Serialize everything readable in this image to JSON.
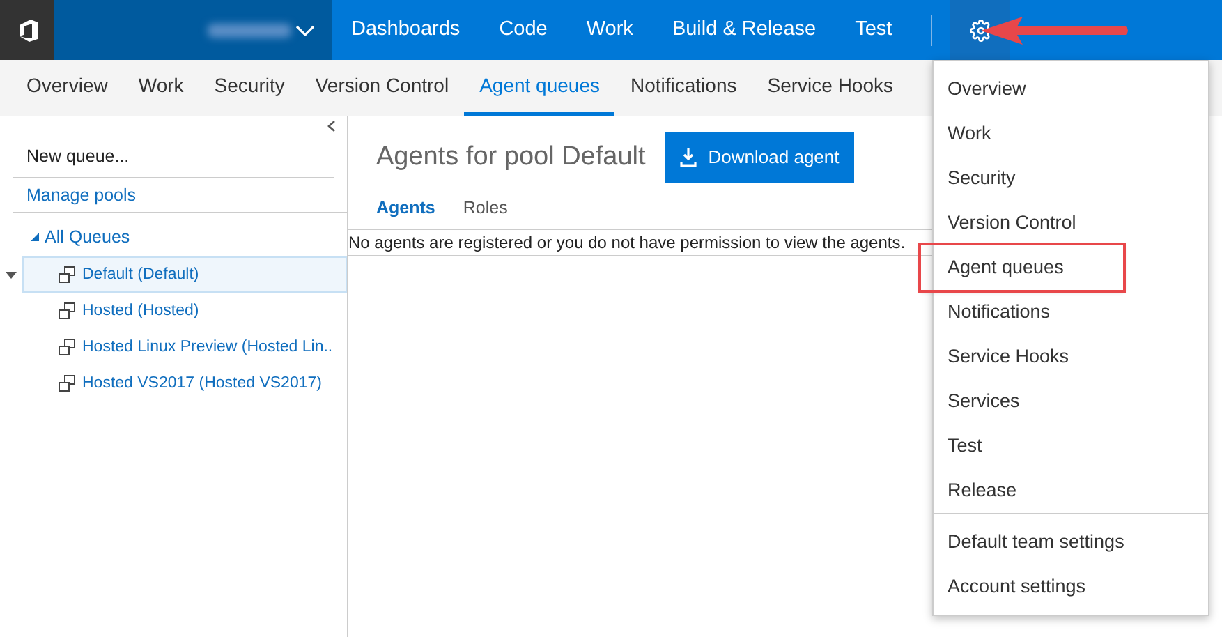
{
  "top_nav": {
    "items": [
      {
        "label": "Dashboards"
      },
      {
        "label": "Code"
      },
      {
        "label": "Work"
      },
      {
        "label": "Build & Release"
      },
      {
        "label": "Test"
      }
    ]
  },
  "tabs": [
    {
      "label": "Overview",
      "selected": false
    },
    {
      "label": "Work",
      "selected": false
    },
    {
      "label": "Security",
      "selected": false
    },
    {
      "label": "Version Control",
      "selected": false
    },
    {
      "label": "Agent queues",
      "selected": true
    },
    {
      "label": "Notifications",
      "selected": false
    },
    {
      "label": "Service Hooks",
      "selected": false
    }
  ],
  "sidebar": {
    "new_queue": "New queue...",
    "manage_pools": "Manage pools",
    "root": {
      "label": "All Queues",
      "expanded": true,
      "children": [
        {
          "label": "Default (Default)",
          "selected": true
        },
        {
          "label": "Hosted (Hosted)",
          "selected": false
        },
        {
          "label": "Hosted Linux Preview (Hosted Lin..",
          "selected": false
        },
        {
          "label": "Hosted VS2017 (Hosted VS2017)",
          "selected": false
        }
      ]
    }
  },
  "main": {
    "title": "Agents for pool Default",
    "download_button": "Download agent",
    "subtabs": [
      {
        "label": "Agents",
        "selected": true
      },
      {
        "label": "Roles",
        "selected": false
      }
    ],
    "message": "No agents are registered or you do not have permission to view the agents."
  },
  "settings_menu": {
    "groups": [
      [
        {
          "label": "Overview",
          "highlighted": false
        },
        {
          "label": "Work",
          "highlighted": false
        },
        {
          "label": "Security",
          "highlighted": false
        },
        {
          "label": "Version Control",
          "highlighted": false
        },
        {
          "label": "Agent queues",
          "highlighted": true
        },
        {
          "label": "Notifications",
          "highlighted": false
        },
        {
          "label": "Service Hooks",
          "highlighted": false
        },
        {
          "label": "Services",
          "highlighted": false
        },
        {
          "label": "Test",
          "highlighted": false
        },
        {
          "label": "Release",
          "highlighted": false
        }
      ],
      [
        {
          "label": "Default team settings",
          "highlighted": false
        },
        {
          "label": "Account settings",
          "highlighted": false
        }
      ]
    ]
  }
}
